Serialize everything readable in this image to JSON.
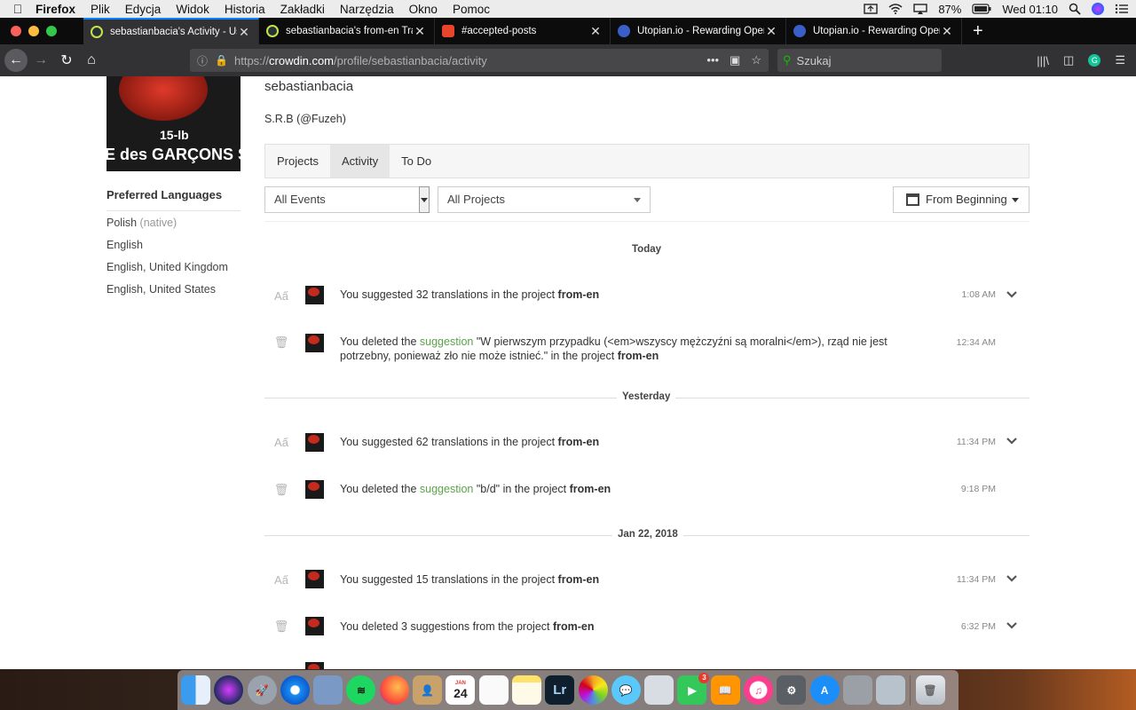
{
  "menubar": {
    "app": "Firefox",
    "items": [
      "Plik",
      "Edycja",
      "Widok",
      "Historia",
      "Zakładki",
      "Narzędzia",
      "Okno",
      "Pomoc"
    ],
    "battery": "87%",
    "clock": "Wed 01:10"
  },
  "tabs": [
    {
      "title": "sebastianbacia's Activity - User",
      "favicon_color": "#263238",
      "active": true
    },
    {
      "title": "sebastianbacia's from-en Trans",
      "favicon_color": "#263238",
      "active": false
    },
    {
      "title": "#accepted-posts",
      "favicon_color": "#e8452b",
      "active": false
    },
    {
      "title": "Utopian.io - Rewarding Open S",
      "favicon_color": "#3a5fc8",
      "active": false
    },
    {
      "title": "Utopian.io - Rewarding Open S",
      "favicon_color": "#3a5fc8",
      "active": false
    }
  ],
  "urlbar": {
    "scheme": "https://",
    "host": "crowdin.com",
    "path": "/profile/sebastianbacia/activity"
  },
  "search": {
    "placeholder": "Szukaj"
  },
  "profile": {
    "avatar_text_1": "15-lb",
    "avatar_text_2": "E des GARÇONS S",
    "username": "sebastianbacia",
    "handle": "S.R.B (@Fuzeh)"
  },
  "languages": {
    "title": "Preferred Languages",
    "items": [
      {
        "name": "Polish",
        "note": "(native)"
      },
      {
        "name": "English",
        "note": ""
      },
      {
        "name": "English, United Kingdom",
        "note": ""
      },
      {
        "name": "English, United States",
        "note": ""
      }
    ]
  },
  "profile_tabs": [
    {
      "label": "Projects",
      "active": false
    },
    {
      "label": "Activity",
      "active": true
    },
    {
      "label": "To Do",
      "active": false
    }
  ],
  "filters": {
    "events": "All Events",
    "projects": "All Projects",
    "date": "From Beginning"
  },
  "days": [
    {
      "label": "Today"
    },
    {
      "label": "Yesterday"
    },
    {
      "label": "Jan 22, 2018"
    }
  ],
  "events": [
    {
      "type": "suggest",
      "prefix": "You suggested 32 translations in the project ",
      "project": "from-en",
      "time": "1:08 AM",
      "expandable": true
    },
    {
      "type": "delete",
      "prefix": "You deleted the ",
      "link": "suggestion",
      "middle": " \"W pierwszym przypadku (<em>wszyscy mężczyźni są moralni</em>), rząd nie jest potrzebny, ponieważ zło nie może istnieć.\" in the project ",
      "project": "from-en",
      "time": "12:34 AM",
      "expandable": false
    },
    {
      "type": "suggest",
      "prefix": "You suggested 62 translations in the project ",
      "project": "from-en",
      "time": "11:34 PM",
      "expandable": true
    },
    {
      "type": "delete",
      "prefix": "You deleted the ",
      "link": "suggestion",
      "middle": " \"b/d\" in the project ",
      "project": "from-en",
      "time": "9:18 PM",
      "expandable": false
    },
    {
      "type": "suggest",
      "prefix": "You suggested 15 translations in the project ",
      "project": "from-en",
      "time": "11:34 PM",
      "expandable": true
    },
    {
      "type": "delete",
      "prefix": "You deleted 3 suggestions from the project ",
      "project": "from-en",
      "time": "6:32 PM",
      "expandable": true
    }
  ],
  "dock": {
    "calendar_day": "24",
    "calendar_month": "JAN",
    "facetime_badge": "3",
    "lightroom_label": "Lr"
  },
  "colors": {
    "accent_tab": "#0a84ff",
    "link_green": "#5aa34a",
    "secure_green": "#12bc00"
  }
}
